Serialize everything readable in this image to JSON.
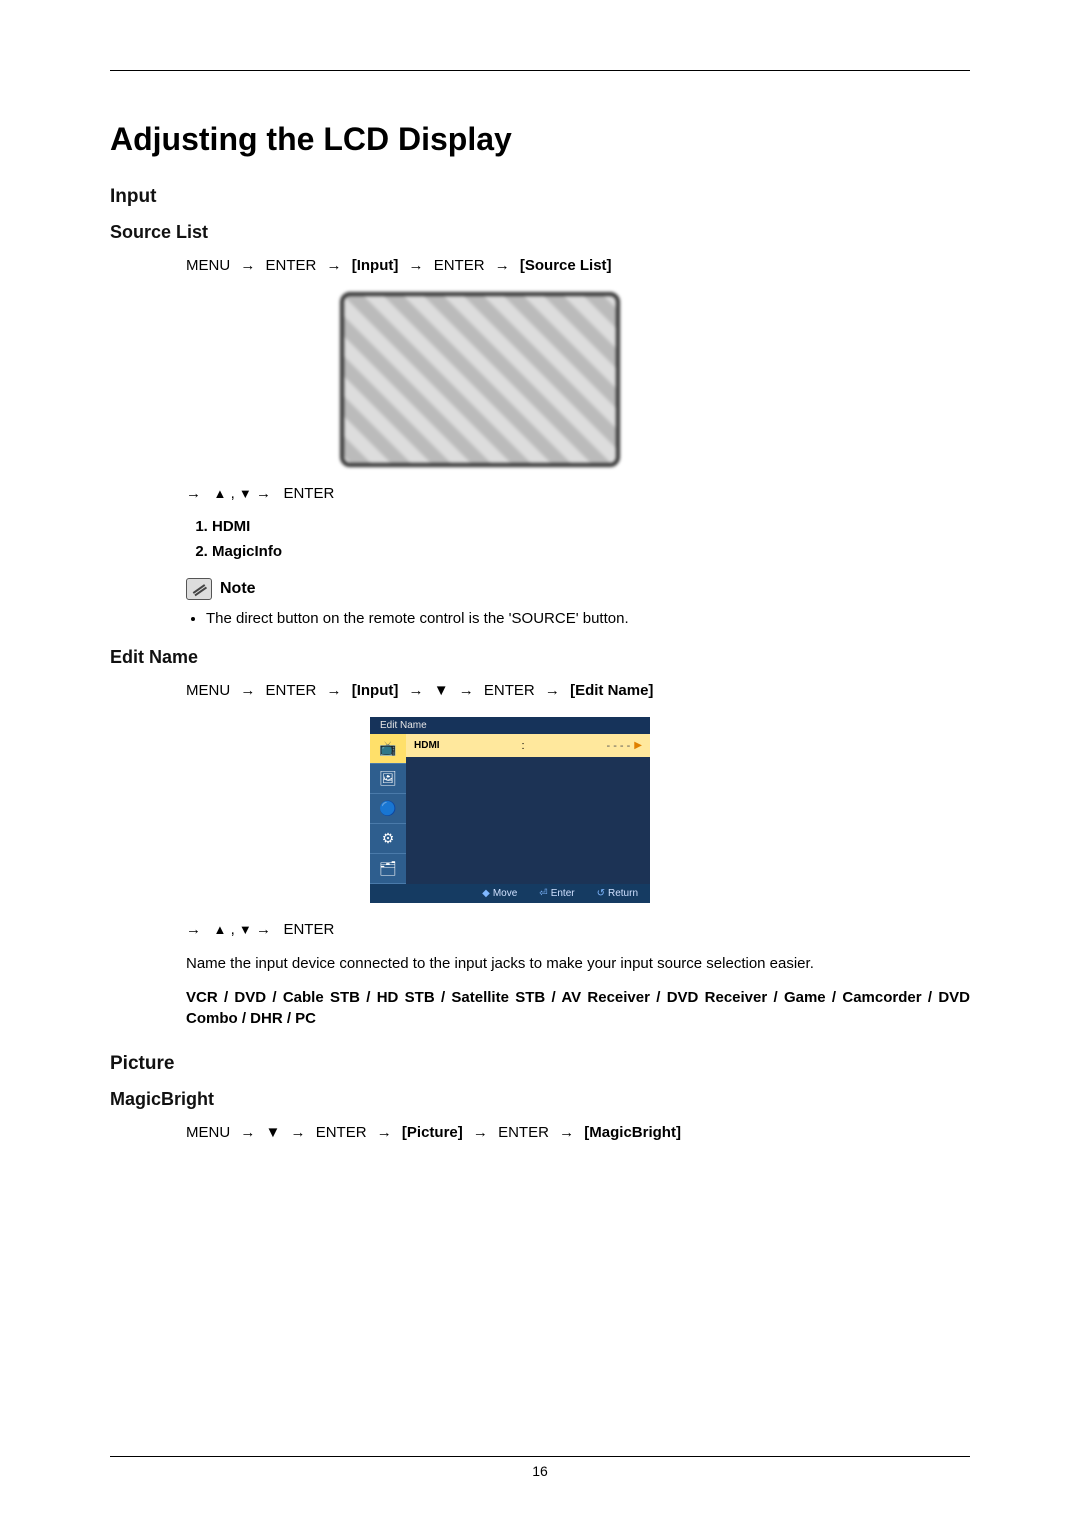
{
  "page": {
    "number": "16",
    "title": "Adjusting the LCD Display"
  },
  "input": {
    "heading": "Input",
    "source_list": {
      "heading": "Source List",
      "breadcrumb": {
        "p1": "MENU",
        "p2": "ENTER",
        "p3": "[Input]",
        "p4": "ENTER",
        "p5": "[Source List]"
      },
      "nav_enter": "ENTER",
      "items": [
        "HDMI",
        "MagicInfo"
      ],
      "note_label": "Note",
      "note_bullet": "The direct button on the remote control is the 'SOURCE' button."
    },
    "edit_name": {
      "heading": "Edit Name",
      "breadcrumb": {
        "p1": "MENU",
        "p2": "ENTER",
        "p3": "[Input]",
        "p4": "ENTER",
        "p5": "[Edit Name]"
      },
      "osd": {
        "header": "Edit Name",
        "row_label": "HDMI",
        "row_sep": ":",
        "row_value": "- - - -",
        "footer": {
          "move": "Move",
          "enter": "Enter",
          "return": "Return"
        }
      },
      "nav_enter": "ENTER",
      "para": "Name the input device connected to the input jacks to make your input source selection easier.",
      "options": "VCR / DVD / Cable STB / HD STB / Satellite STB / AV Receiver / DVD Receiver / Game / Camcorder / DVD Combo / DHR / PC"
    }
  },
  "picture": {
    "heading": "Picture",
    "magicbright": {
      "heading": "MagicBright",
      "breadcrumb": {
        "p1": "MENU",
        "p2": "ENTER",
        "p3": "[Picture]",
        "p4": "ENTER",
        "p5": "[MagicBright]"
      }
    }
  },
  "glyphs": {
    "right_arrow": "→",
    "up_tri": "▲",
    "down_tri": "▼",
    "comma": " , "
  }
}
